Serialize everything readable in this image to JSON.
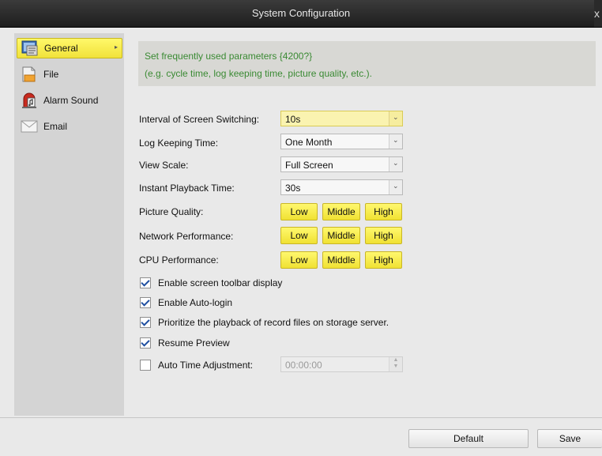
{
  "window": {
    "title": "System Configuration",
    "close_glyph": "x"
  },
  "sidebar": {
    "items": [
      {
        "label": "General",
        "icon": "general-settings-icon",
        "active": true
      },
      {
        "label": "File",
        "icon": "file-icon",
        "active": false
      },
      {
        "label": "Alarm Sound",
        "icon": "alarm-sound-icon",
        "active": false
      },
      {
        "label": "Email",
        "icon": "email-icon",
        "active": false
      }
    ],
    "active_arrow": "▸"
  },
  "info": {
    "line1": "Set frequently used parameters  {4200?}",
    "line2": "(e.g. cycle time, log keeping time, picture quality, etc.)."
  },
  "settings": {
    "screen_switching": {
      "label": "Interval of Screen Switching:",
      "value": "10s"
    },
    "log_keeping": {
      "label": "Log Keeping Time:",
      "value": "One Month"
    },
    "view_scale": {
      "label": "View Scale:",
      "value": "Full Screen"
    },
    "playback_time": {
      "label": "Instant Playback Time:",
      "value": "30s"
    },
    "picture_quality": {
      "label": "Picture Quality:",
      "options": [
        "Low",
        "Middle",
        "High"
      ]
    },
    "network_performance": {
      "label": "Network Performance:",
      "options": [
        "Low",
        "Middle",
        "High"
      ]
    },
    "cpu_performance": {
      "label": "CPU Performance:",
      "options": [
        "Low",
        "Middle",
        "High"
      ]
    }
  },
  "checkboxes": {
    "toolbar_display": {
      "label": "Enable screen toolbar display",
      "checked": true
    },
    "auto_login": {
      "label": "Enable Auto-login",
      "checked": true
    },
    "prioritize_playback": {
      "label": "Prioritize the playback of record files on storage server.",
      "checked": true
    },
    "resume_preview": {
      "label": "Resume Preview",
      "checked": true
    },
    "auto_time": {
      "label": "Auto Time Adjustment:",
      "checked": false,
      "time_value": "00:00:00"
    }
  },
  "dropdown_glyph": "⌄",
  "footer": {
    "default_label": "Default",
    "save_label": "Save"
  },
  "colors": {
    "accent_yellow": "#f5e84a",
    "info_text_green": "#3a8a33",
    "check_blue": "#1f4fa0"
  }
}
